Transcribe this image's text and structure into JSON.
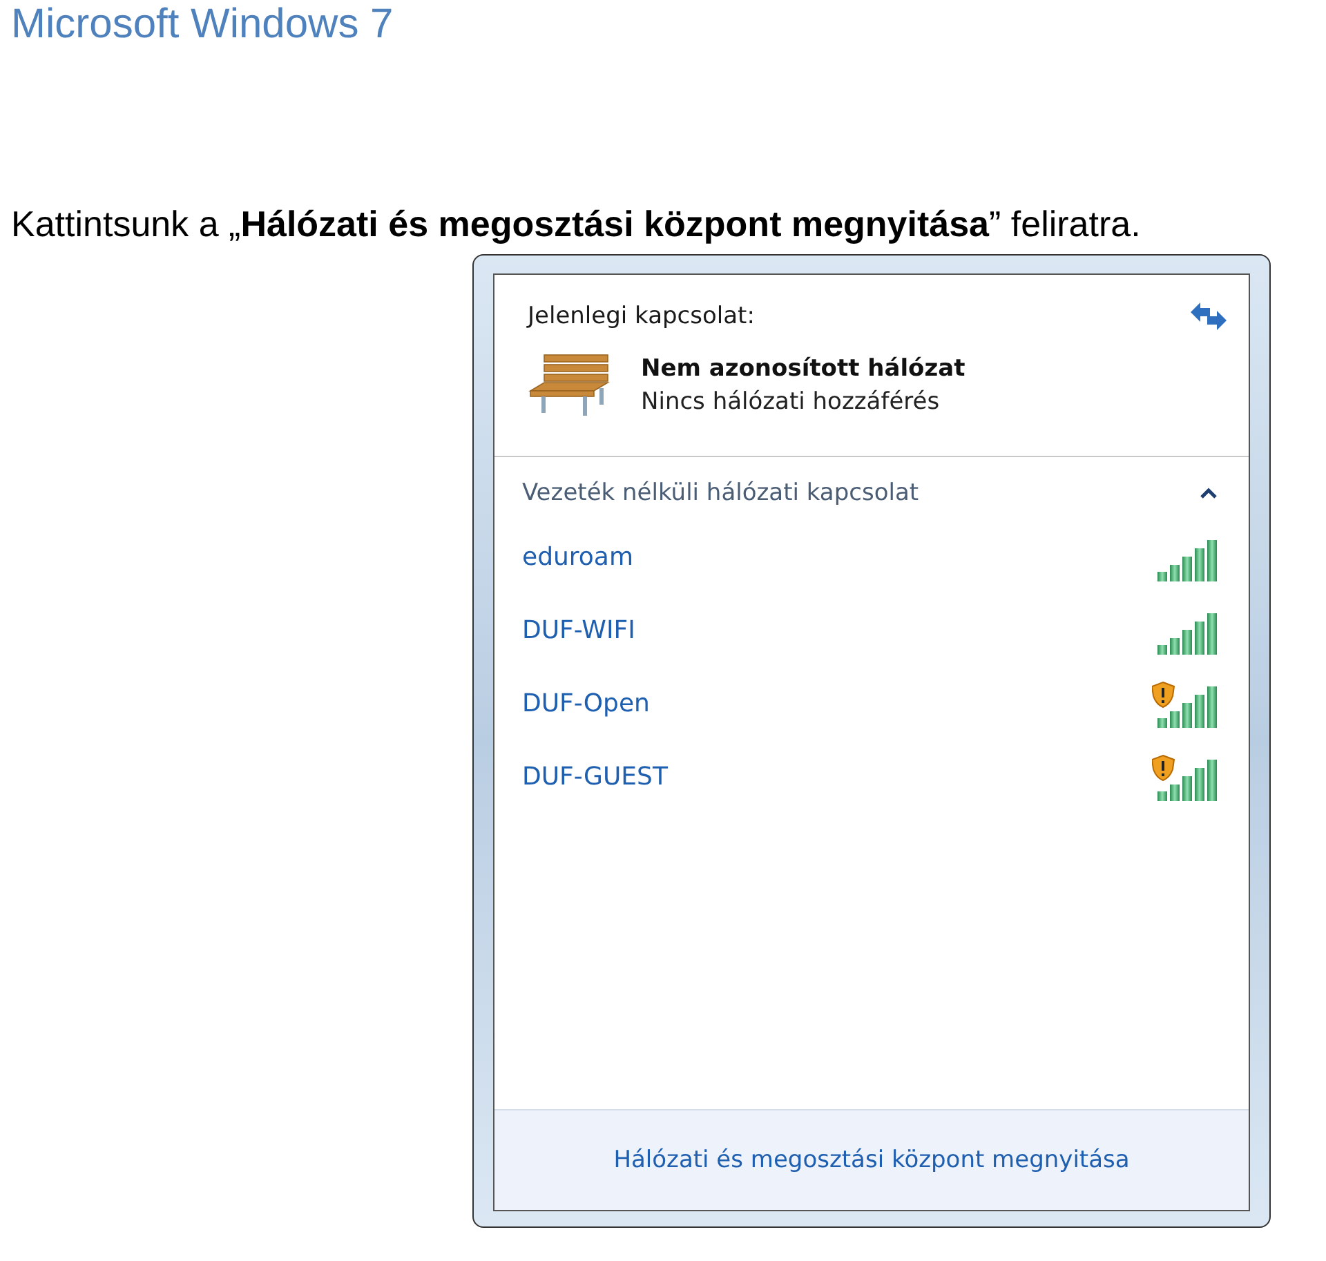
{
  "document": {
    "heading": "Microsoft Windows 7",
    "instruction": "Kattintsunk a „**Hálózati és megosztási központ megnyitása**” feliratra."
  },
  "flyout": {
    "current_label": "Jelenlegi kapcsolat:",
    "network": {
      "name": "Nem azonosított hálózat",
      "status": "Nincs hálózati hozzáférés"
    },
    "section": {
      "title": "Vezeték nélküli hálózati kapcsolat",
      "expanded": true
    },
    "networks": [
      {
        "name": "eduroam",
        "unsecured": false
      },
      {
        "name": "DUF-WIFI",
        "unsecured": false
      },
      {
        "name": "DUF-Open",
        "unsecured": true
      },
      {
        "name": "DUF-GUEST",
        "unsecured": true
      }
    ],
    "footer_link": "Hálózati és megosztási központ megnyitása"
  }
}
